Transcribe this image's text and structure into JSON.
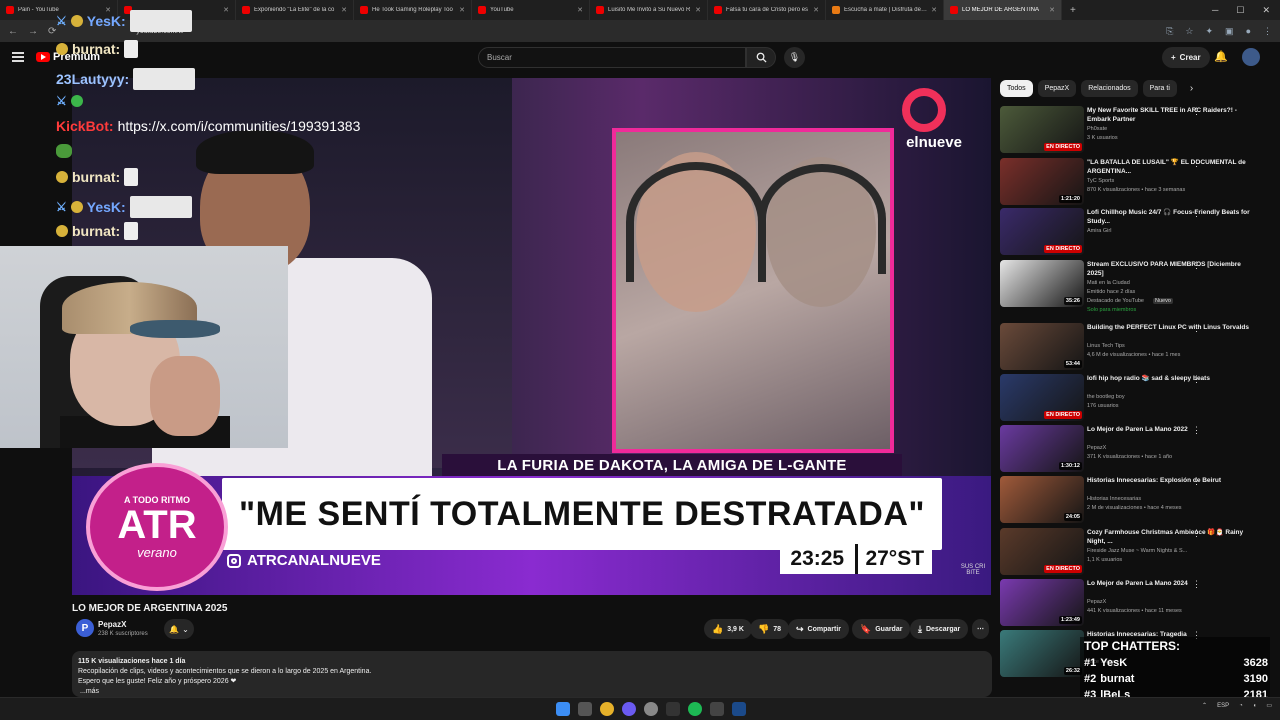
{
  "browser": {
    "tabs": [
      {
        "label": "Pain - YouTube",
        "active": false
      },
      {
        "label": "",
        "active": false
      },
      {
        "label": "Exponiendo \"La Elite\" de la co",
        "active": false
      },
      {
        "label": "He Took Gaming Roleplay Too",
        "active": false
      },
      {
        "label": "YouTube",
        "active": false
      },
      {
        "label": "Luisito Me Invitó a Su Nuevo R",
        "active": false
      },
      {
        "label": "Falsa tu cara de Cristo pero es",
        "active": false
      },
      {
        "label": "Escucha a mate | Disfruta de la",
        "active": false
      },
      {
        "label": "LO MEJOR DE ARGENTINA",
        "active": true
      }
    ],
    "url": "youtube.com/w"
  },
  "youtube": {
    "logo_text": "Premium",
    "search_placeholder": "Buscar",
    "create_label": "Crear"
  },
  "stream_chat": [
    {
      "user": "YesK:",
      "type": "yesk"
    },
    {
      "user": "burnat:",
      "type": "burnat"
    },
    {
      "user": "23Lautyyy:",
      "type": "laut"
    },
    {
      "user": "",
      "type": "badges"
    },
    {
      "user": "KickBot:",
      "type": "kick",
      "message": "https://x.com/i/communities/199391383"
    },
    {
      "user": "",
      "type": "frog"
    },
    {
      "user": "burnat:",
      "type": "burnat"
    },
    {
      "user": "YesK:",
      "type": "yesk"
    },
    {
      "user": "burnat:",
      "type": "burnat"
    }
  ],
  "video": {
    "channel_logo": "elnueve",
    "strip_text": "LA FURIA DE DAKOTA, LA AMIGA DE L-GANTE",
    "headline": "\"ME SENTÍ TOTALMENTE DESTRATADA\"",
    "instagram": "ATRCANALNUEVE",
    "time": "23:25",
    "temperature": "27°ST",
    "badge_top": "A TODO RITMO",
    "badge_main": "ATR",
    "badge_sub": "verano",
    "subscribe_mark": "SUS CRI BITE"
  },
  "watch": {
    "title": "LO MEJOR DE ARGENTINA 2025",
    "channel_name": "PepazX",
    "channel_subs": "238 K suscriptores",
    "likes": "3,9 K",
    "dislikes": "78",
    "share": "Compartir",
    "save": "Guardar",
    "download": "Descargar",
    "views": "115 K visualizaciones  hace 1 día",
    "desc1": "Recopilación de clips, videos y acontecimientos que se dieron a lo largo de 2025 en Argentina.",
    "desc2": "Espero que les guste! Feliz año y próspero 2026 ❤",
    "more": "...más"
  },
  "chips": [
    "Todos",
    "PepazX",
    "Relacionados",
    "Para ti"
  ],
  "recommendations": [
    {
      "title": "My New Favorite SKILL TREE in ARC Raiders?! - Embark Partner",
      "channel": "Ph0xate",
      "meta": "3 K usuarios",
      "badge": "EN DIRECTO",
      "live": true,
      "color": "#4c5a3a"
    },
    {
      "title": "\"LA BATALLA DE LUSAIL\" 🏆 EL DOCUMENTAL de ARGENTINA...",
      "channel": "TyC Sports",
      "meta": "870 K visualizaciones • hace 3 semanas",
      "badge": "1:21:20",
      "live": false,
      "color": "#7a2f2a"
    },
    {
      "title": "Lofi Chillhop Music 24/7 🎧 Focus-Friendly Beats for Study...",
      "channel": "Amira Girl",
      "meta": "",
      "badge": "EN DIRECTO",
      "live": true,
      "color": "#3a2a6a"
    },
    {
      "title": "Stream EXCLUSIVO PARA MIEMBROS [Diciembre 2025]",
      "channel": "Mati en la Ciudad",
      "meta": "Emitido hace 2 días",
      "meta2": "Destacado de YouTube",
      "nuevo": "Nuevo",
      "members": "Solo para miembros",
      "badge": "35:26",
      "live": false,
      "color": "#e6e6e6"
    },
    {
      "title": "Building the PERFECT Linux PC with Linus Torvalds",
      "channel": "Linus Tech Tips",
      "meta": "4,6 M de visualizaciones • hace 1 mes",
      "badge": "53:44",
      "live": false,
      "color": "#6a4a3a"
    },
    {
      "title": "lofi hip hop radio 📚 sad & sleepy beats",
      "channel": "the bootleg boy",
      "meta": "176 usuarios",
      "badge": "EN DIRECTO",
      "live": true,
      "color": "#2a3a6a"
    },
    {
      "title": "Lo Mejor de Paren La Mano 2022",
      "channel": "PepazX",
      "meta": "371 K visualizaciones • hace 1 año",
      "badge": "1:30:12",
      "live": false,
      "color": "#6a3aa0"
    },
    {
      "title": "Historias Innecesarias: Explosión de Beirut",
      "channel": "Historias Innecesarias",
      "meta": "2 M de visualizaciones • hace 4 meses",
      "badge": "24:05",
      "live": false,
      "color": "#a05a3a"
    },
    {
      "title": "Cozy Farmhouse Christmas Ambience 🎁🎅 Rainy Night, ...",
      "channel": "Fireside Jazz Muse ~ Warm Nights & S...",
      "meta": "1,1 K usuarios",
      "badge": "EN DIRECTO",
      "live": true,
      "color": "#5a3a2a"
    },
    {
      "title": "Lo Mejor de Paren La Mano 2024",
      "channel": "PepazX",
      "meta": "441 K visualizaciones • hace 11 meses",
      "badge": "1:23:49",
      "live": false,
      "color": "#7a3ab0"
    },
    {
      "title": "Historias Innecesarias: Tragedia",
      "channel": "",
      "meta": "hace 1 año",
      "badge": "26:32",
      "live": false,
      "color": "#3a7a7a"
    }
  ],
  "chatters": {
    "header": "TOP CHATTERS:",
    "rows": [
      {
        "rank": "#1",
        "name": "YesK",
        "count": "3628"
      },
      {
        "rank": "#2",
        "name": "burnat",
        "count": "3190"
      },
      {
        "rank": "#3",
        "name": "lBeLs",
        "count": "2181"
      }
    ]
  },
  "taskbar": {
    "lang": "ESP"
  },
  "colors": {
    "youtube_red": "#ff0000",
    "accent_pink": "#f02a9a",
    "bg": "#0f0f0f"
  }
}
